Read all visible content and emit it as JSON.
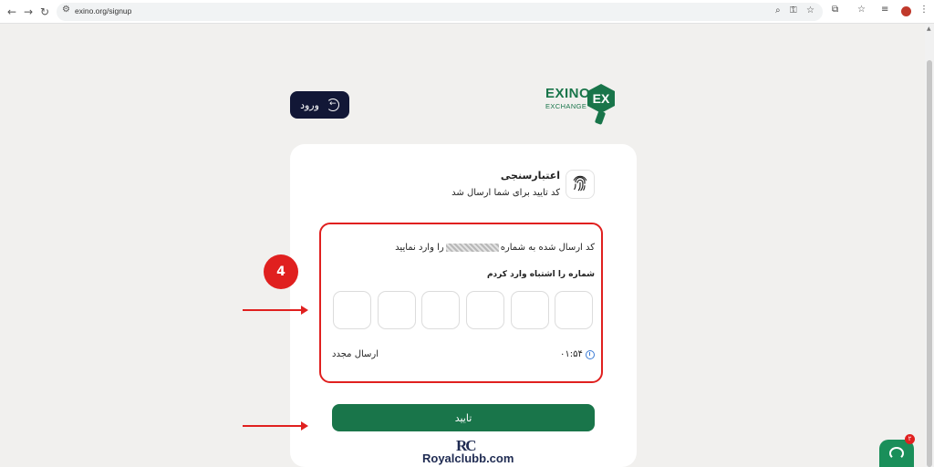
{
  "browser": {
    "url": "exino.org/signup"
  },
  "brand": {
    "name": "EXINO",
    "tagline": "EXCHANGE",
    "mark": "EX",
    "color": "#19754a"
  },
  "header": {
    "login_label": "ورود"
  },
  "card": {
    "title": "اعتبارسنجی",
    "subtitle": "کد تایید برای شما ارسال شد",
    "code_message_before": "کد ارسال شده به شماره",
    "code_message_after": "را وارد نمایید",
    "wrong_number_link": "شماره را اشتباه وارد کردم",
    "otp_digits": [
      "",
      "",
      "",
      "",
      "",
      ""
    ],
    "timer": "۰۱:۵۴",
    "resend_label": "ارسال مجدد",
    "confirm_label": "تایید"
  },
  "annotation": {
    "step_number": "4",
    "highlight_color": "#e0201f"
  },
  "watermark": {
    "mark": "RC",
    "text": "Royalclubb.com"
  },
  "chat": {
    "badge_count": "۲"
  }
}
